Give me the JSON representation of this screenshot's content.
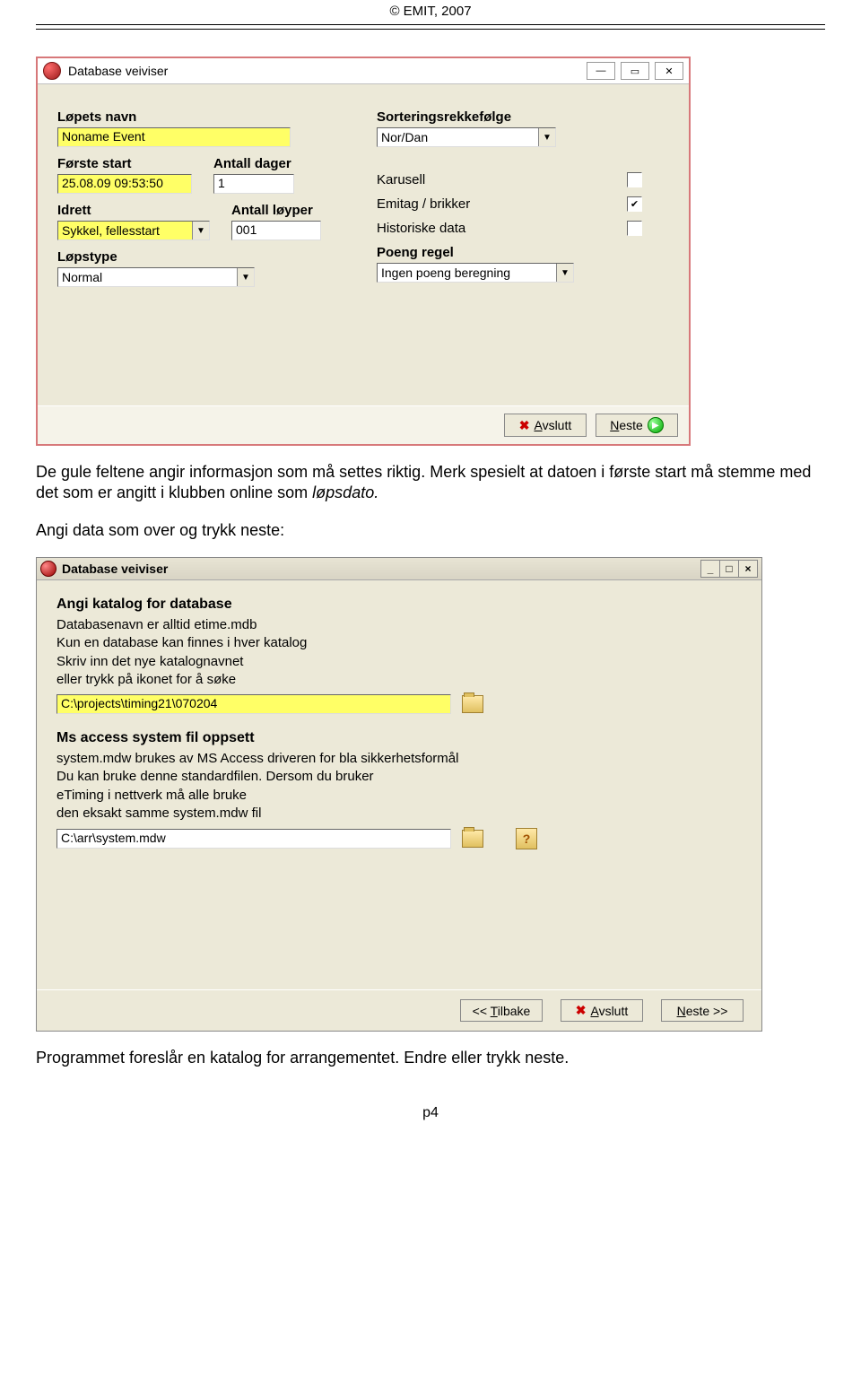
{
  "header": "© EMIT, 2007",
  "win1": {
    "title": "Database veiviser",
    "labels": {
      "name": "Løpets navn",
      "sort": "Sorteringsrekkefølge",
      "first_start": "Første start",
      "days": "Antall dager",
      "sport": "Idrett",
      "courses": "Antall løyper",
      "racetype": "Løpstype",
      "pointrule": "Poeng regel",
      "karusell": "Karusell",
      "emitag": "Emitag / brikker",
      "historic": "Historiske data"
    },
    "values": {
      "name": "Noname Event",
      "sort": "Nor/Dan",
      "first_start": "25.08.09 09:53:50",
      "days": "1",
      "sport": "Sykkel, fellesstart",
      "courses": "001",
      "racetype": "Normal",
      "pointrule": "Ingen poeng beregning",
      "karusell_checked": false,
      "emitag_checked": true,
      "historic_checked": false
    },
    "buttons": {
      "cancel": "Avslutt",
      "next": "Neste",
      "cancel_key": "A",
      "next_key": "N"
    }
  },
  "para1": "De gule feltene angir informasjon som må settes riktig. Merk spesielt at datoen i første start må stemme med det som er angitt i klubben online som ",
  "para1_i": "løpsdato.",
  "para2": "Angi data som over og trykk neste:",
  "win2": {
    "title": "Database veiviser",
    "section1": {
      "heading": "Angi katalog for database",
      "line1": "Databasenavn er alltid etime.mdb",
      "line2": "Kun en database kan finnes i hver katalog",
      "line3": "Skriv inn det nye katalognavnet",
      "line4": "eller trykk på ikonet for å søke",
      "path": "C:\\projects\\timing21\\070204"
    },
    "section2": {
      "heading": "Ms access system fil oppsett",
      "line1": "system.mdw brukes av MS Access driveren for bla sikkerhetsformål",
      "line2": "Du kan bruke denne standardfilen. Dersom du bruker",
      "line3": "eTiming  i nettverk må alle bruke",
      "line4": "den eksakt samme system.mdw fil",
      "path": "C:\\arr\\system.mdw"
    },
    "buttons": {
      "back": "<< Tilbake",
      "cancel": "Avslutt",
      "next": "Neste >>",
      "back_key": "T",
      "cancel_key": "A",
      "next_key": "N"
    }
  },
  "para3": "Programmet foreslår en katalog for arrangementet. Endre eller trykk neste.",
  "page_num": "p4"
}
